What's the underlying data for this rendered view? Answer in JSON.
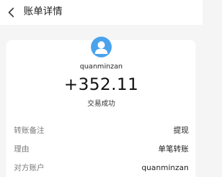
{
  "header": {
    "title": "账单详情",
    "back_icon": "chevron-left-icon"
  },
  "payee": {
    "avatar_icon": "user-avatar-icon",
    "avatar_color": "#4aa3ec",
    "username": "quanminzan",
    "amount": "+352.11",
    "status": "交易成功"
  },
  "details": [
    {
      "label": "转账备注",
      "value": "提现"
    },
    {
      "label": "理由",
      "value": "单笔转账"
    },
    {
      "label": "对方账户",
      "value": "quanminzan"
    }
  ]
}
